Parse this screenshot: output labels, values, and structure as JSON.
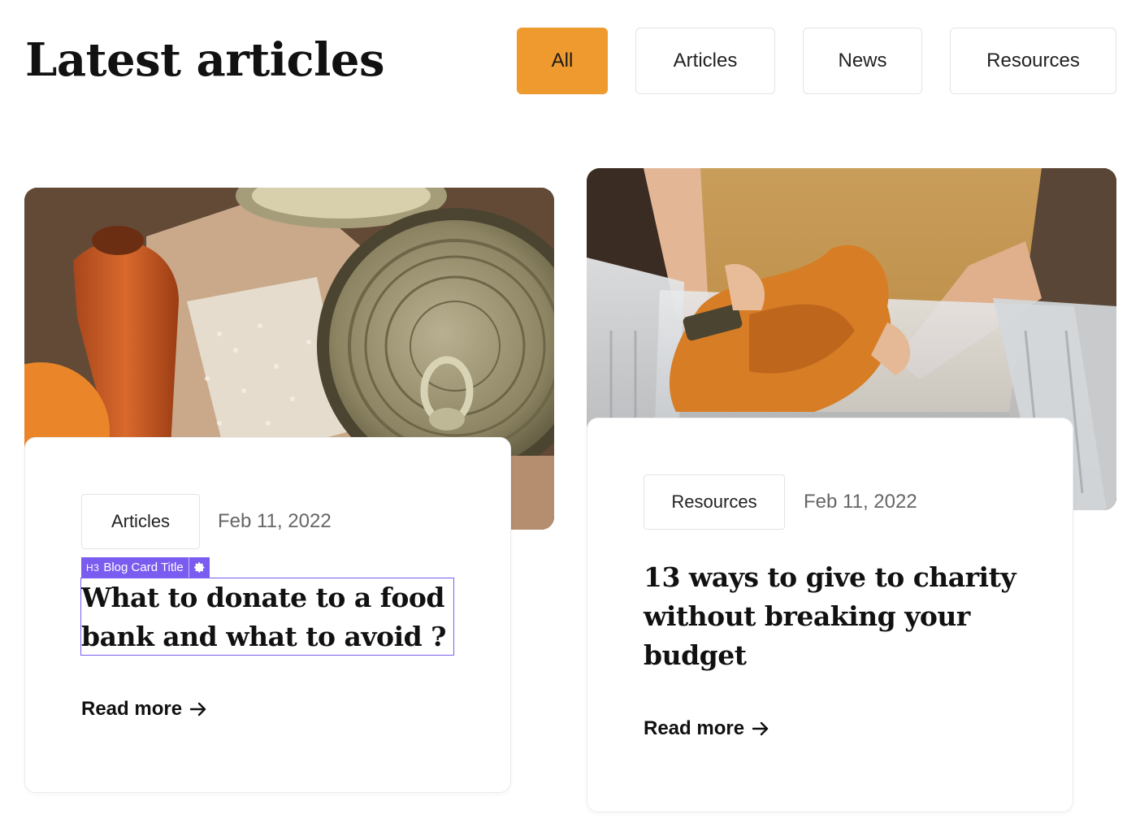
{
  "header": {
    "title": "Latest articles"
  },
  "filters": [
    {
      "label": "All",
      "active": true
    },
    {
      "label": "Articles",
      "active": false
    },
    {
      "label": "News",
      "active": false
    },
    {
      "label": "Resources",
      "active": false
    }
  ],
  "colors": {
    "accent": "#ef9a2e",
    "editor_highlight": "#7b5cf0"
  },
  "editor_overlay": {
    "badge": "H3",
    "label": "Blog Card Title",
    "icon": "gear-icon"
  },
  "cards": [
    {
      "image": "food-donation-cans-carrot-rice-photo",
      "tag": "Articles",
      "date": "Feb 11, 2022",
      "title": "What to donate to a food bank and what to avoid ?",
      "read_more": "Read more",
      "read_more_icon": "arrow-right-icon"
    },
    {
      "image": "person-folding-clothes-into-bins-photo",
      "tag": "Resources",
      "date": "Feb 11, 2022",
      "title": "13 ways to give to charity without breaking your budget",
      "read_more": "Read more",
      "read_more_icon": "arrow-right-icon"
    }
  ]
}
